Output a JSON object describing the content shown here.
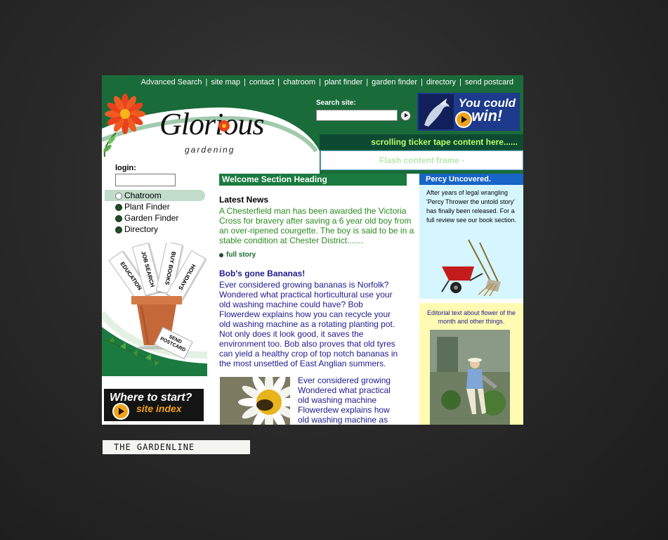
{
  "topnav": {
    "items": [
      "Advanced Search",
      "site map",
      "contact",
      "chatroom",
      "plant finder",
      "garden finder",
      "directory",
      "send postcard"
    ],
    "separator": "|"
  },
  "logo": {
    "title": "Glorious",
    "subtitle": "gardening"
  },
  "search": {
    "label": "Search site:",
    "value": ""
  },
  "win_banner": {
    "line1": "You could",
    "line2": "win!"
  },
  "ticker": {
    "text": "scrolling ticker tape content here......"
  },
  "flash_frame": {
    "text": "Flash content frame  -"
  },
  "login": {
    "label": "login:",
    "value": ""
  },
  "leftnav": {
    "items": [
      {
        "label": "Chatroom",
        "active": true
      },
      {
        "label": "Plant Finder",
        "active": false
      },
      {
        "label": "Garden Finder",
        "active": false
      },
      {
        "label": "Directory",
        "active": false
      }
    ]
  },
  "promo_tags": {
    "education": "EDUCATION",
    "job_search": "JOB SEARCH",
    "buy_books": "BUY BOOKS",
    "holidays": "HOLIDAYS",
    "send_postcard": "SEND POSTCARD"
  },
  "site_index": {
    "line1": "Where to start?",
    "line2": "site index"
  },
  "welcome": {
    "heading": "Welcome Section Heading"
  },
  "latest_news": {
    "heading": "Latest News",
    "body": "A  Chesterfield man has been awarded the Victoria Cross for bravery after saving a 6 year old boy from an over-ripened courgette.  The boy is said to be in a stable condition at Chester District.......",
    "link": "full story"
  },
  "bob": {
    "heading": "Bob's gone Bananas!",
    "body": "Ever considered growing bananas is Norfolk? Wondered what practical horticultural use your old washing machine could have? Bob Flowerdew explains how you can  recycle your old  washing machine as a rotating planting pot. Not only does it look good, it saves the environment too.  Bob also proves that old tyres can yield a healthy crop of top notch bananas in the most unsettled of East Anglian summers.",
    "body2": "Ever considered growing Wondered what practical old washing machine Flowerdew explains how old  washing machine as"
  },
  "percy": {
    "heading": "Percy Uncovered.",
    "body": "After years of legal wrangling 'Percy Thrower the untold story' has finally  been released.  For a  full review see our book section."
  },
  "editorial": {
    "text": "Editorial text about flower of the month and other things."
  },
  "footer": {
    "gardenline": "THE GARDENLINE"
  },
  "colors": {
    "header_green": "#1a6b3a",
    "ticker_text": "#b8ff6a",
    "news_green": "#2a8a1f",
    "story_blue": "#1f1a8c",
    "percy_blue": "#1864c8",
    "percy_bg": "#d6f6ff",
    "editorial_bg": "#fffbb3"
  }
}
